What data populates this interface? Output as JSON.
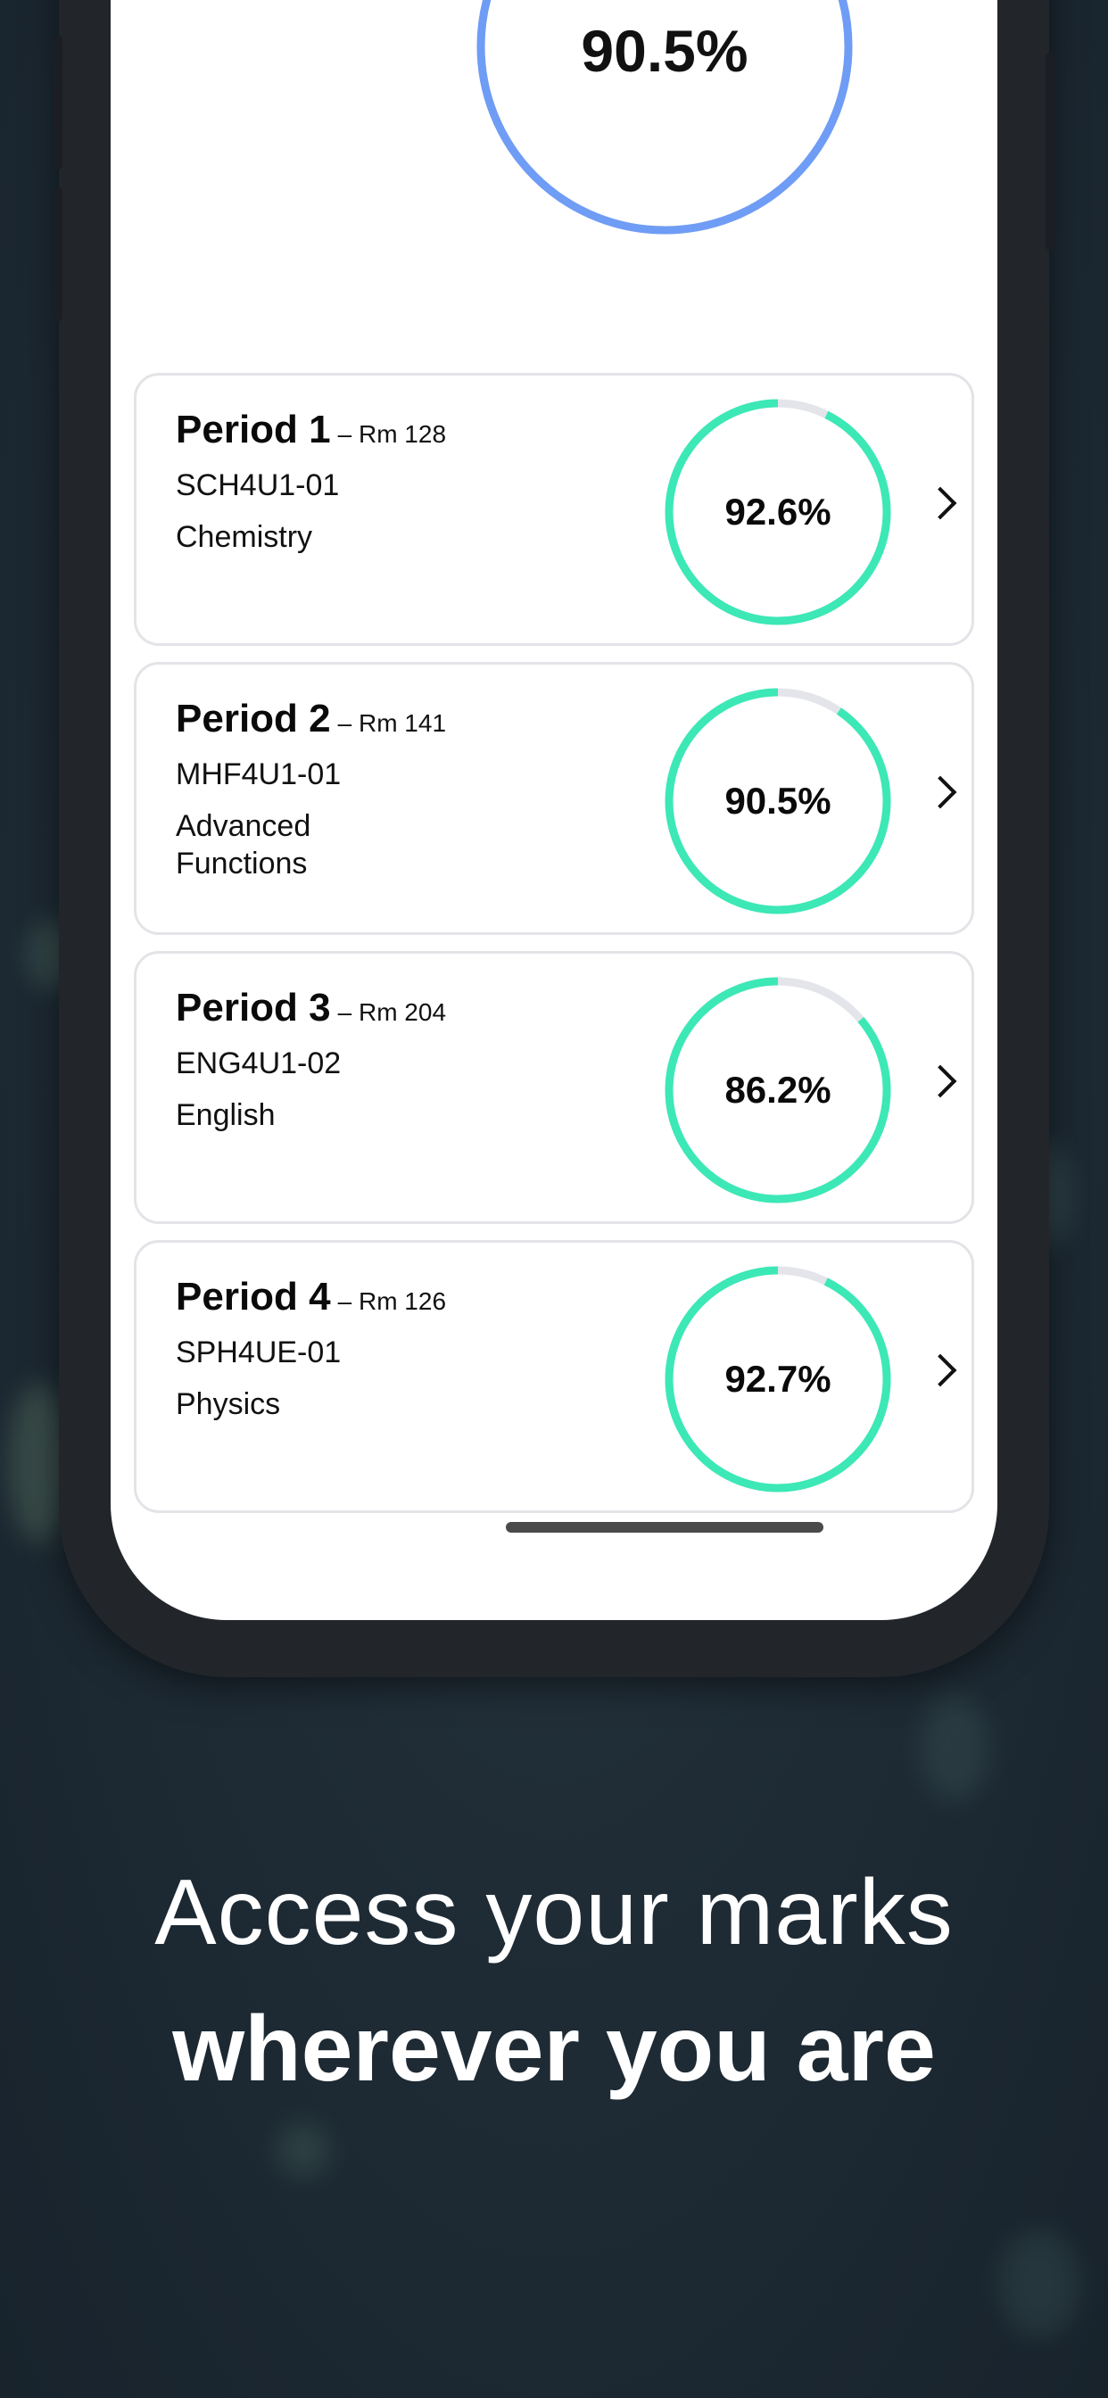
{
  "overall": {
    "value": "90.5%",
    "fraction": 0.905
  },
  "courses": [
    {
      "period": "Period 1",
      "room": "– Rm 128",
      "code": "SCH4U1-01",
      "name": "Chemistry",
      "mark": "92.6%",
      "fraction": 0.926
    },
    {
      "period": "Period 2",
      "room": "– Rm 141",
      "code": "MHF4U1-01",
      "name": "Advanced Functions",
      "mark": "90.5%",
      "fraction": 0.905
    },
    {
      "period": "Period 3",
      "room": "– Rm 204",
      "code": "ENG4U1-02",
      "name": "English",
      "mark": "86.2%",
      "fraction": 0.862
    },
    {
      "period": "Period 4",
      "room": "– Rm 126",
      "code": "SPH4UE-01",
      "name": "Physics",
      "mark": "92.7%",
      "fraction": 0.927
    }
  ],
  "tagline": {
    "line1": "Access your marks",
    "line2": "wherever you are"
  },
  "colors": {
    "overall_ring": "#6f9cf5",
    "course_ring": "#3ce8b6",
    "ring_track": "#e4e5ea",
    "background": "#1f2c36"
  },
  "icons": {
    "card_chevron": "chevron-right-icon"
  }
}
